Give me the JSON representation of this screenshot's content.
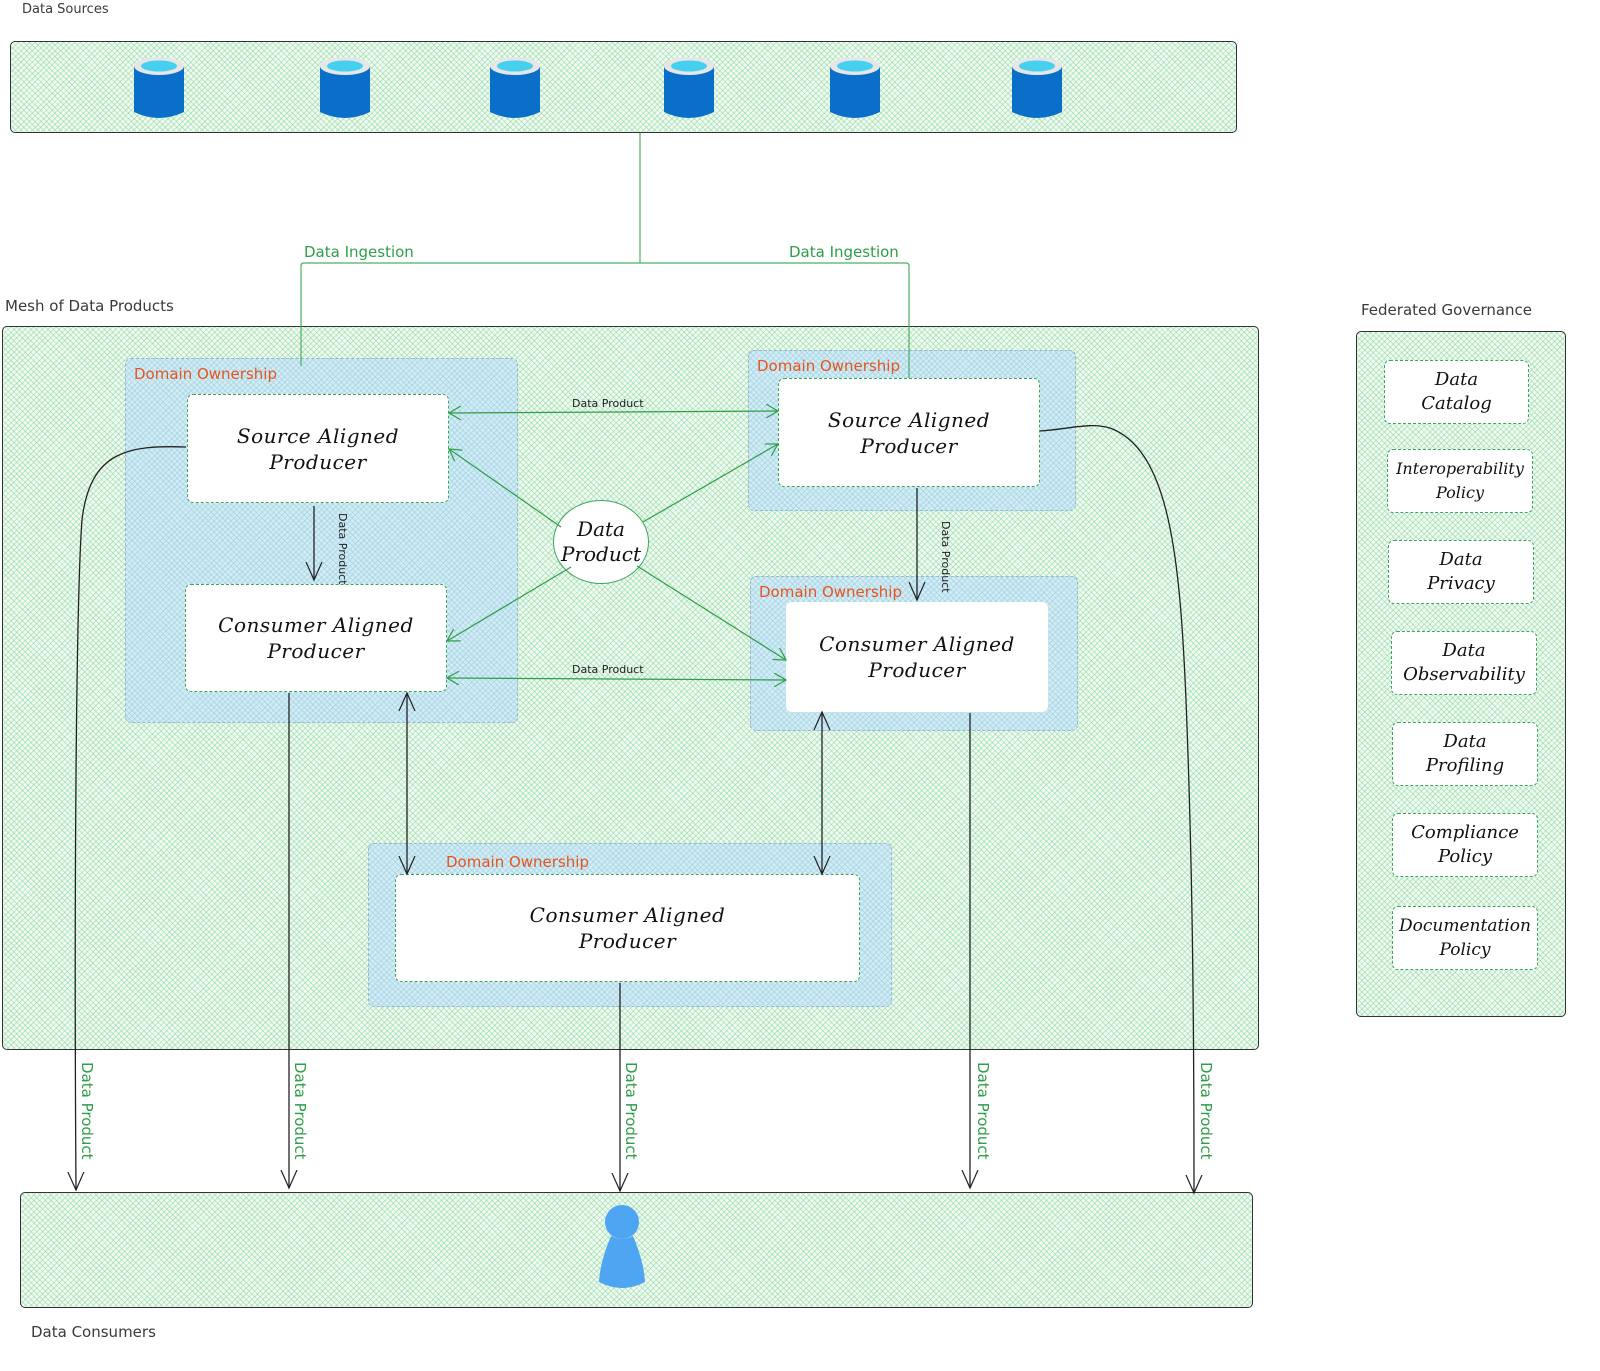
{
  "sections": {
    "data_sources": "Data Sources",
    "mesh": "Mesh of Data Products",
    "governance": "Federated Governance",
    "consumers": "Data Consumers"
  },
  "data_sources": {
    "count": 6,
    "icon": "database-cylinder-icon",
    "colors": {
      "body": "#0a6fc8",
      "top_rim": "#e6e6e6",
      "top_fill": "#45d0f0"
    }
  },
  "ingestion": {
    "left_label": "Data Ingestion",
    "right_label": "Data Ingestion"
  },
  "domains": [
    {
      "label": "Domain Ownership",
      "node": [
        "Source Aligned",
        "Producer"
      ],
      "node2": [
        "Consumer Aligned",
        "Producer"
      ]
    },
    {
      "label": "Domain Ownership",
      "node": [
        "Source Aligned",
        "Producer"
      ]
    },
    {
      "label": "Domain Ownership",
      "node": [
        "Consumer Aligned",
        "Producer"
      ]
    },
    {
      "label": "Domain Ownership",
      "node": [
        "Consumer Aligned",
        "Producer"
      ]
    }
  ],
  "hub": {
    "line1": "Data",
    "line2": "Product"
  },
  "edges": {
    "top": "Data Product",
    "bottom": "Data Product",
    "left_vertical": "Data Product",
    "right_vertical": "Data Product"
  },
  "outputs": [
    "Data Product",
    "Data Product",
    "Data Product",
    "Data Product",
    "Data Product"
  ],
  "governance": [
    {
      "line1": "Data",
      "line2": "Catalog"
    },
    {
      "line1": "Interoperability",
      "line2": "Policy"
    },
    {
      "line1": "Data",
      "line2": "Privacy"
    },
    {
      "line1": "Data",
      "line2": "Observability"
    },
    {
      "line1": "Data",
      "line2": "Profiling"
    },
    {
      "line1": "Compliance",
      "line2": "Policy"
    },
    {
      "line1": "Documentation",
      "line2": "Policy"
    }
  ],
  "consumer_icon": {
    "name": "user-icon",
    "color": "#4ea5f2"
  },
  "colors": {
    "accent_green": "#2e9e48",
    "domain_label": "#e8541e",
    "hatch_green": "#e6f7e8",
    "hatch_blue": "#d3ecf4"
  }
}
